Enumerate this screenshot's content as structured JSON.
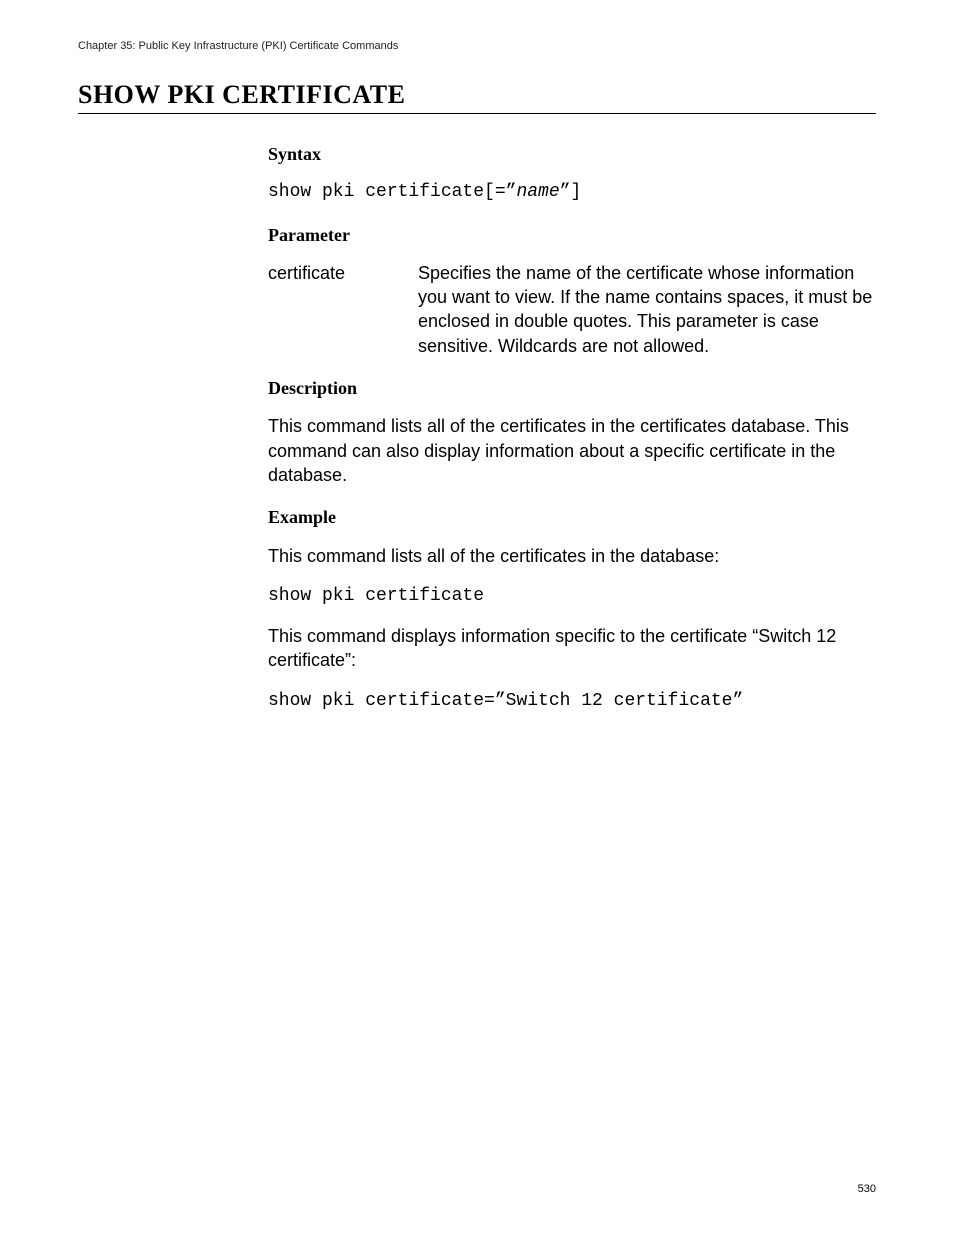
{
  "header": {
    "chapter": "Chapter 35: Public Key Infrastructure (PKI) Certificate Commands"
  },
  "title": "SHOW PKI CERTIFICATE",
  "sections": {
    "syntax": {
      "heading": "Syntax",
      "cmd_prefix": "show pki certificate[=”",
      "cmd_ital": "name",
      "cmd_suffix": "”]"
    },
    "parameter": {
      "heading": "Parameter",
      "name": "certificate",
      "desc": "Specifies the name of the certificate whose information you want to view. If the name contains spaces, it must be enclosed in double quotes. This parameter is case sensitive. Wildcards are not allowed."
    },
    "description": {
      "heading": "Description",
      "para": "This command lists all of the certificates in the certificates database. This command can also display information about a specific certificate in the database."
    },
    "example": {
      "heading": "Example",
      "para1": "This command lists all of the certificates in the database:",
      "code1": "show pki certificate",
      "para2": "This command displays information specific to the certificate “Switch 12 certificate”:",
      "code2": "show pki certificate=”Switch 12 certificate”"
    }
  },
  "page_number": "530"
}
